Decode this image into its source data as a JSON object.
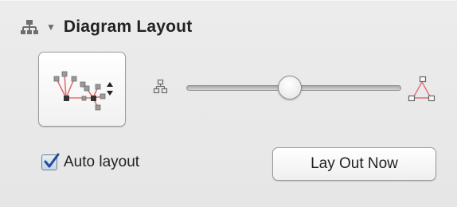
{
  "header": {
    "title": "Diagram Layout",
    "icon": "diagram-layout-icon",
    "disclosure_icon": "triangle-down-icon"
  },
  "layout_style_button": {
    "icon": "tree-layout-icon",
    "popup_icon": "popup-arrows-icon"
  },
  "spacing_slider": {
    "min_icon": "compact-spacing-icon",
    "max_icon": "expanded-spacing-icon",
    "value": 0.48
  },
  "auto_layout": {
    "label": "Auto layout",
    "checked": true
  },
  "lay_out_now_button": {
    "label": "Lay Out Now"
  },
  "colors": {
    "background": "#e8e8e8",
    "connector_accent": "#e07070",
    "checkmark": "#1f4e9c"
  }
}
